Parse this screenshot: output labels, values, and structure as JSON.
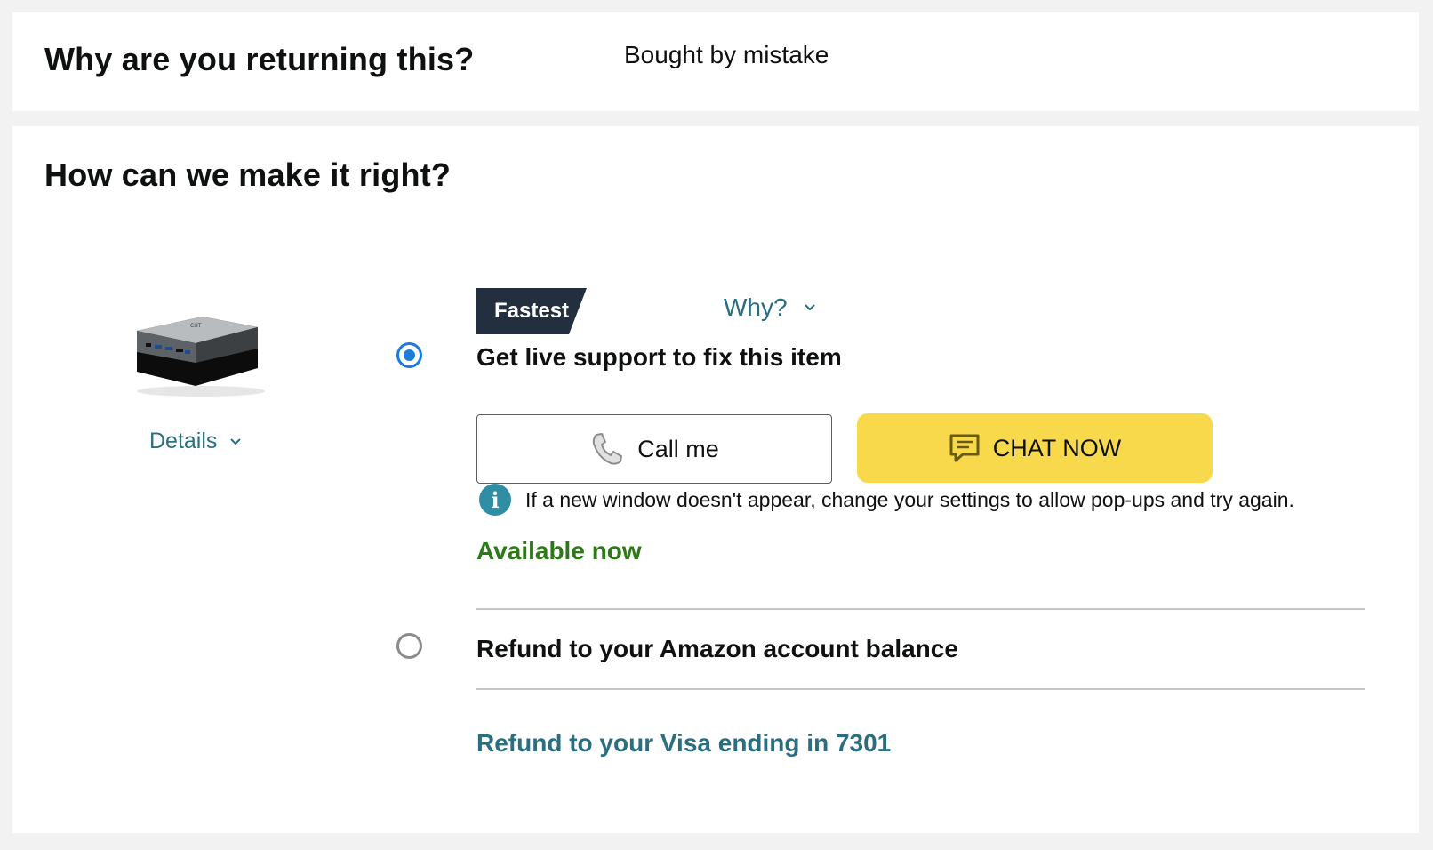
{
  "reason_section": {
    "heading": "Why are you returning this?",
    "value": "Bought by mistake"
  },
  "resolve_section": {
    "heading": "How can we make it right?",
    "product": {
      "details_label": "Details"
    },
    "options": [
      {
        "badge": "Fastest",
        "why_label": "Why?",
        "title": "Get live support to fix this item",
        "selected": true,
        "call_label": "Call me",
        "chat_label": "CHAT NOW",
        "info_text": "If a new window doesn't appear, change your settings to allow pop-ups and try again.",
        "availability": "Available now"
      },
      {
        "title": "Refund to your Amazon account balance",
        "selected": false
      }
    ],
    "refund_visa_label": "Refund to your Visa ending in 7301"
  },
  "colors": {
    "link": "#2a6f80",
    "available": "#2b7a16",
    "chat_button": "#f7d94b",
    "radio_selected": "#1f7ae0",
    "badge": "#232f3e"
  },
  "icons": [
    "product-image",
    "chevron-down-icon",
    "phone-icon",
    "chat-icon",
    "info-icon"
  ]
}
